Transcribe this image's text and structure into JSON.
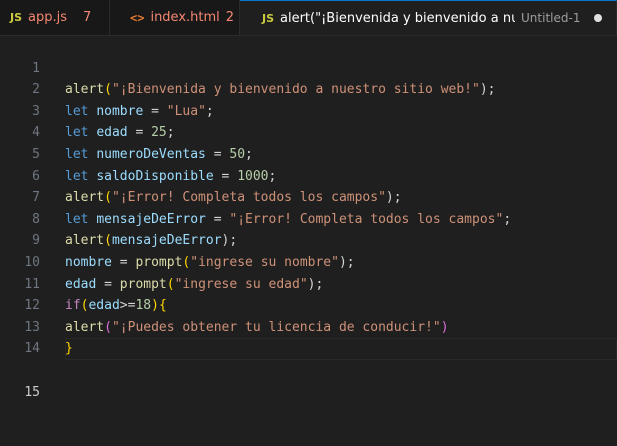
{
  "tabs": [
    {
      "icon": "JS",
      "name": "app.js",
      "count": "7"
    },
    {
      "icon": "<>",
      "name": "index.html",
      "count": "2"
    },
    {
      "icon": "JS",
      "name": "alert(\"¡Bienvenida y bienvenido a nuestr",
      "detail": "Untitled-1"
    }
  ],
  "lines": [
    {
      "n": "1",
      "t": [
        "alert",
        "(",
        "\"¡Bienvenida y bienvenido a nuestro sitio web!\"",
        ");"
      ]
    },
    {
      "n": "2",
      "t": [
        "let",
        " ",
        "nombre",
        " = ",
        "\"Lua\"",
        ";"
      ]
    },
    {
      "n": "3",
      "t": [
        "let",
        " ",
        "edad",
        " = ",
        "25",
        ";"
      ]
    },
    {
      "n": "4",
      "t": [
        "let",
        " ",
        "numeroDeVentas",
        " = ",
        "50",
        ";"
      ]
    },
    {
      "n": "5",
      "t": [
        "let",
        " ",
        "saldoDisponible",
        " = ",
        "1000",
        ";"
      ]
    },
    {
      "n": "6",
      "t": [
        "alert",
        "(",
        "\"¡Error! Completa todos los campos\"",
        ");"
      ]
    },
    {
      "n": "7",
      "t": [
        "let",
        " ",
        "mensajeDeError",
        " = ",
        "\"¡Error! Completa todos los campos\"",
        ";"
      ]
    },
    {
      "n": "8",
      "t": [
        "alert",
        "(",
        "mensajeDeError",
        ");"
      ]
    },
    {
      "n": "9",
      "t": [
        "nombre",
        " = ",
        "prompt",
        "(",
        "\"ingrese su nombre\"",
        ");"
      ]
    },
    {
      "n": "10",
      "t": [
        "edad",
        " = ",
        "prompt",
        "(",
        "\"ingrese su edad\"",
        ");"
      ]
    },
    {
      "n": "11",
      "t": [
        "if",
        "(",
        "edad",
        ">=",
        "18",
        ")",
        "{"
      ]
    },
    {
      "n": "12",
      "t": [
        "alert",
        "(",
        "\"¡Puedes obtener tu licencia de conducir!\"",
        ")"
      ]
    },
    {
      "n": "13",
      "t": [
        "}"
      ]
    },
    {
      "n": "14",
      "t": []
    },
    {
      "n": "15",
      "t": []
    }
  ]
}
